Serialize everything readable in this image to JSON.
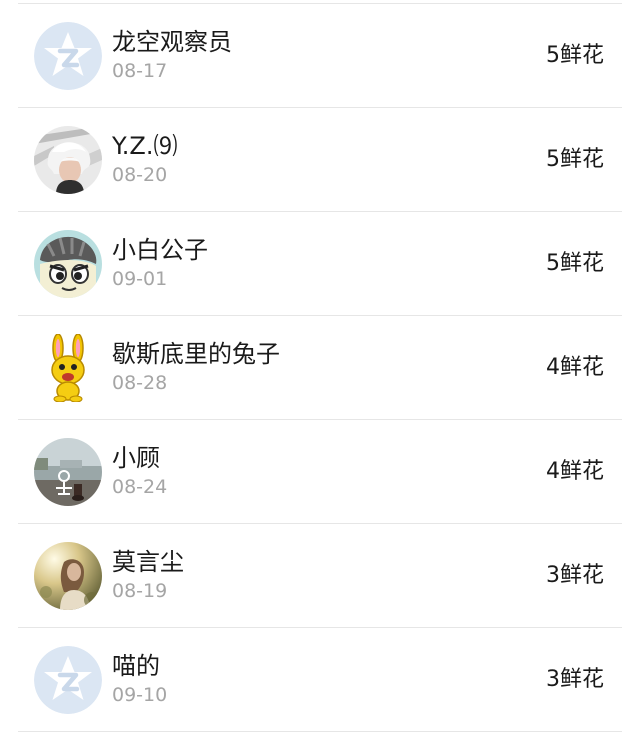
{
  "rows": [
    {
      "name": "龙空观察员",
      "date": "08-17",
      "count": "5鲜花",
      "avatar": "default-qq-avatar"
    },
    {
      "name": "Y.Z.⑼",
      "date": "08-20",
      "count": "5鲜花",
      "avatar": "photo-white-hair"
    },
    {
      "name": "小白公子",
      "date": "09-01",
      "count": "5鲜花",
      "avatar": "cartoon-face"
    },
    {
      "name": "歇斯底里的兔子",
      "date": "08-28",
      "count": "4鲜花",
      "avatar": "yellow-bunny"
    },
    {
      "name": "小顾",
      "date": "08-24",
      "count": "4鲜花",
      "avatar": "photo-lakeside"
    },
    {
      "name": "莫言尘",
      "date": "08-19",
      "count": "3鲜花",
      "avatar": "photo-sunlight-girl"
    },
    {
      "name": "喵的",
      "date": "09-10",
      "count": "3鲜花",
      "avatar": "default-qq-avatar"
    }
  ]
}
